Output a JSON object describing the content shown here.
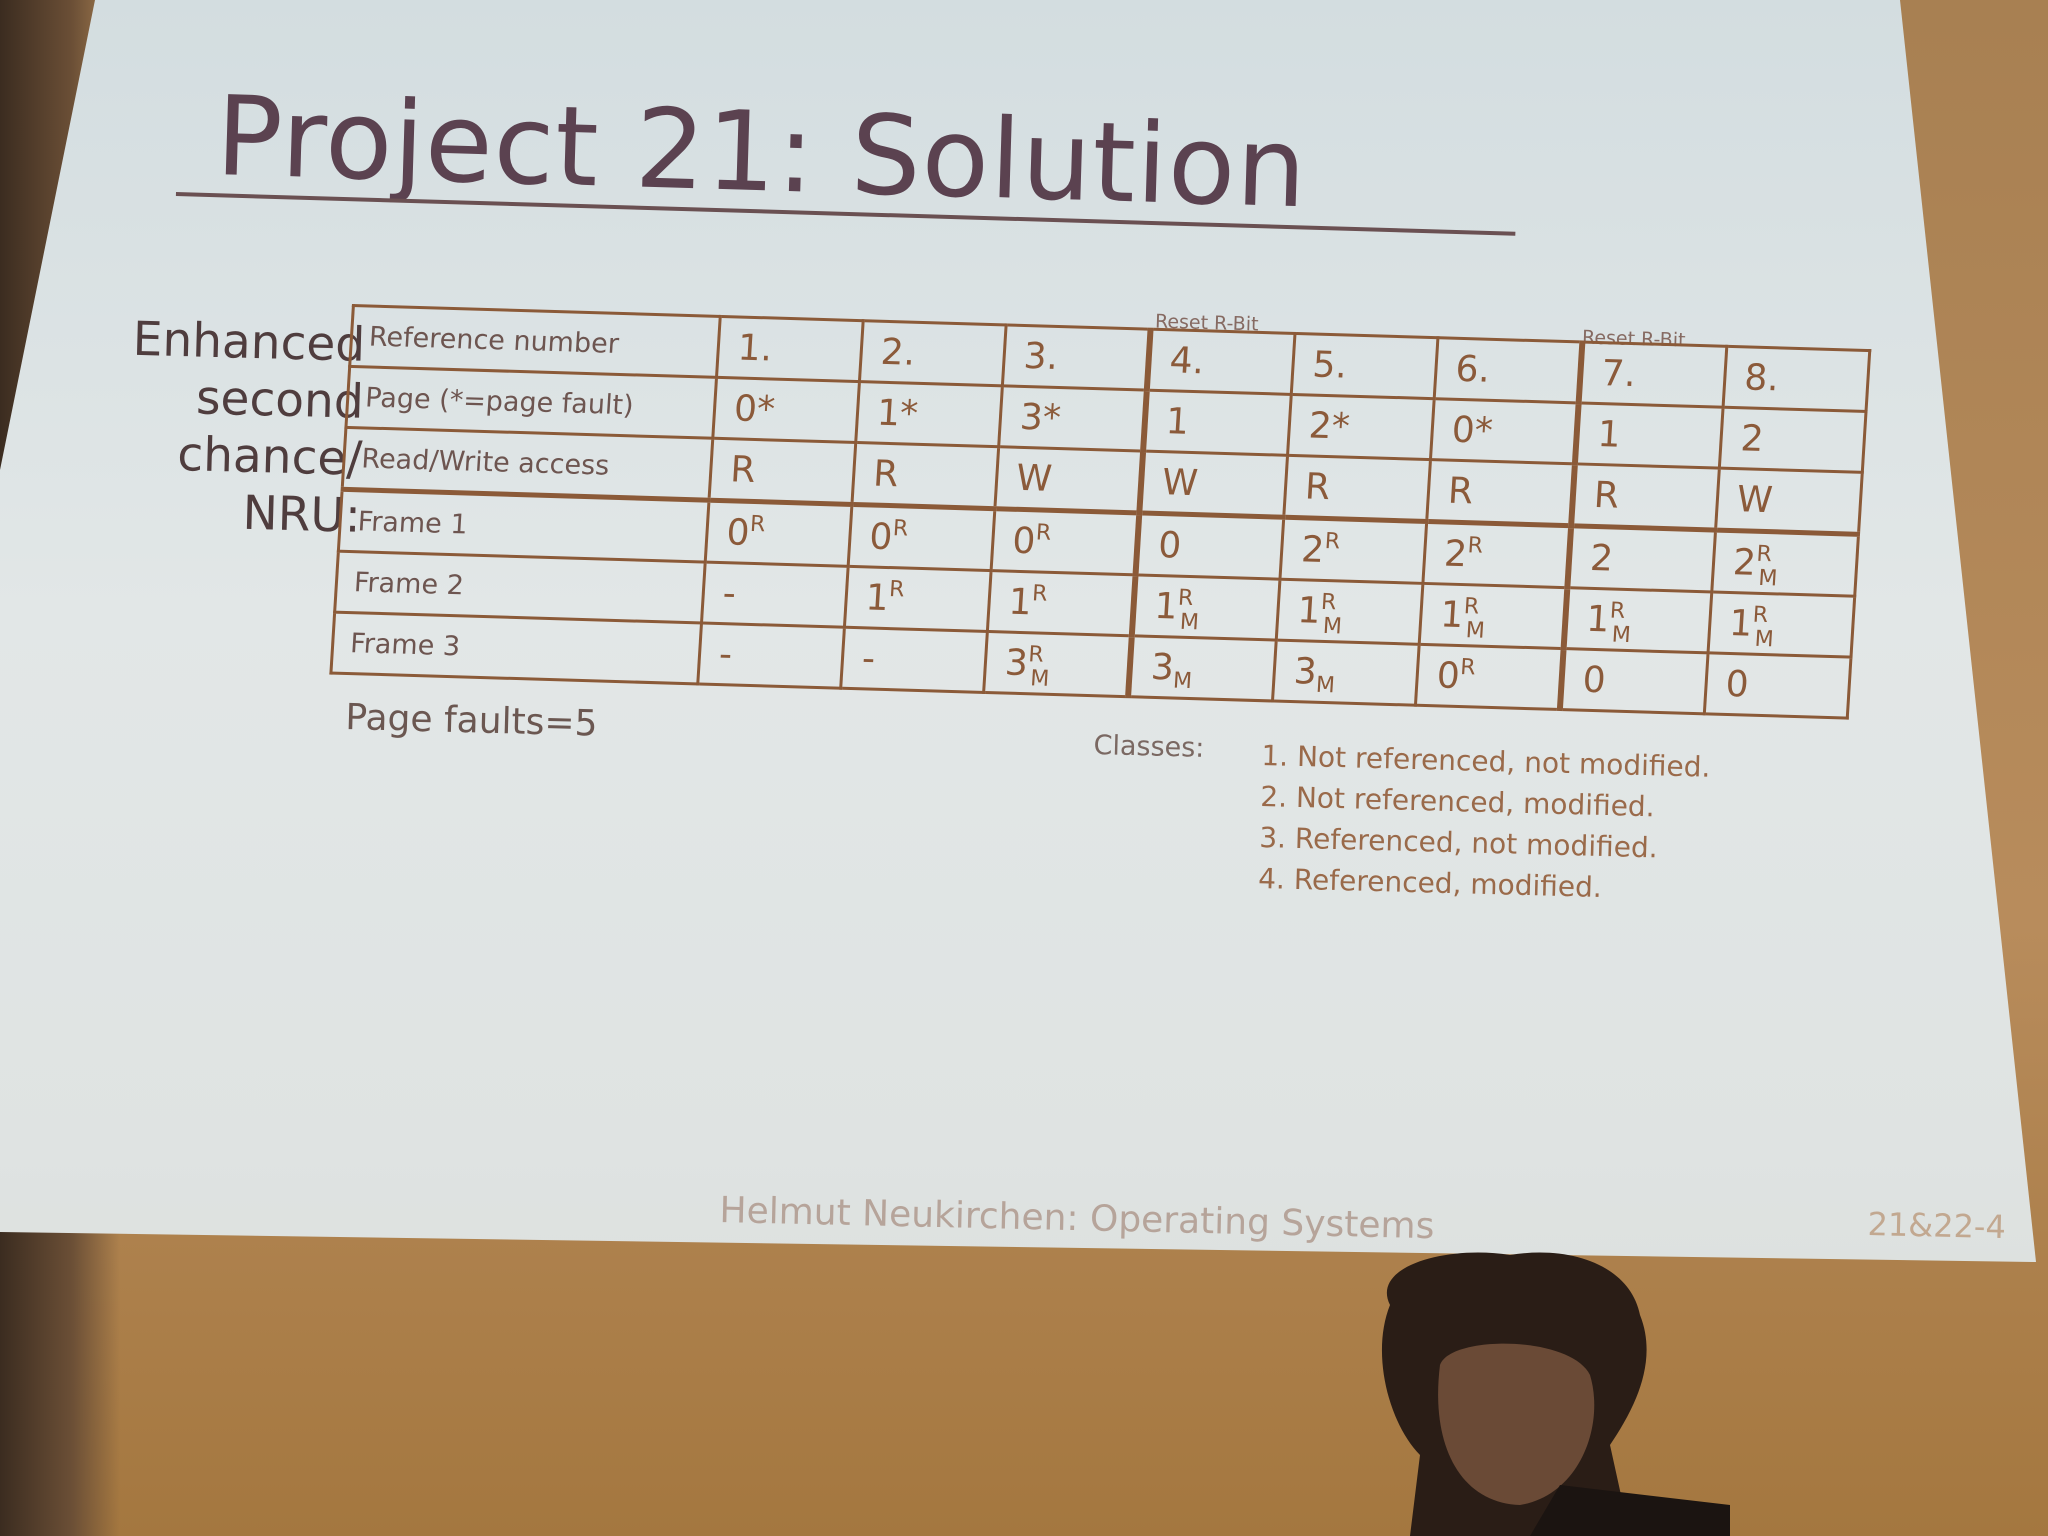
{
  "slide": {
    "title": "Project 21: Solution",
    "side_label_lines": [
      "Enhanced",
      "second",
      "chance/",
      "NRU:"
    ],
    "reset_notes": [
      "Reset R-Bit",
      "Reset R-Bit"
    ],
    "page_faults": "Page faults=5",
    "classes_label": "Classes:",
    "classes": [
      "1. Not referenced, not modified.",
      "2. Not referenced, modified.",
      "3. Referenced, not modified.",
      "4. Referenced, modified."
    ],
    "footer": "Helmut Neukirchen: Operating Systems",
    "page_number": "21&22-4"
  },
  "table": {
    "rows": [
      {
        "header": "Reference number",
        "cells": [
          "1.",
          "2.",
          "3.",
          "4.",
          "5.",
          "6.",
          "7.",
          "8."
        ]
      },
      {
        "header": "Page (*=page fault)",
        "cells": [
          "0*",
          "1*",
          "3*",
          "1",
          "2*",
          "0*",
          "1",
          "2"
        ]
      },
      {
        "header": "Read/Write access",
        "cells": [
          "R",
          "R",
          "W",
          "W",
          "R",
          "R",
          "R",
          "W"
        ]
      },
      {
        "header": "Frame 1",
        "cells": [
          {
            "v": "0",
            "sup": "R",
            "sub": ""
          },
          {
            "v": "0",
            "sup": "R",
            "sub": ""
          },
          {
            "v": "0",
            "sup": "R",
            "sub": ""
          },
          {
            "v": "0",
            "sup": "",
            "sub": ""
          },
          {
            "v": "2",
            "sup": "R",
            "sub": ""
          },
          {
            "v": "2",
            "sup": "R",
            "sub": ""
          },
          {
            "v": "2",
            "sup": "",
            "sub": ""
          },
          {
            "v": "2",
            "sup": "R",
            "sub": "M"
          }
        ]
      },
      {
        "header": "Frame 2",
        "cells": [
          {
            "v": "-",
            "sup": "",
            "sub": ""
          },
          {
            "v": "1",
            "sup": "R",
            "sub": ""
          },
          {
            "v": "1",
            "sup": "R",
            "sub": ""
          },
          {
            "v": "1",
            "sup": "R",
            "sub": "M"
          },
          {
            "v": "1",
            "sup": "R",
            "sub": "M"
          },
          {
            "v": "1",
            "sup": "R",
            "sub": "M"
          },
          {
            "v": "1",
            "sup": "R",
            "sub": "M"
          },
          {
            "v": "1",
            "sup": "R",
            "sub": "M"
          }
        ]
      },
      {
        "header": "Frame 3",
        "cells": [
          {
            "v": "-",
            "sup": "",
            "sub": ""
          },
          {
            "v": "-",
            "sup": "",
            "sub": ""
          },
          {
            "v": "3",
            "sup": "R",
            "sub": "M"
          },
          {
            "v": "3",
            "sup": "",
            "sub": "M"
          },
          {
            "v": "3",
            "sup": "",
            "sub": "M"
          },
          {
            "v": "0",
            "sup": "R",
            "sub": ""
          },
          {
            "v": "0",
            "sup": "",
            "sub": ""
          },
          {
            "v": "0",
            "sup": "",
            "sub": ""
          }
        ]
      }
    ]
  }
}
